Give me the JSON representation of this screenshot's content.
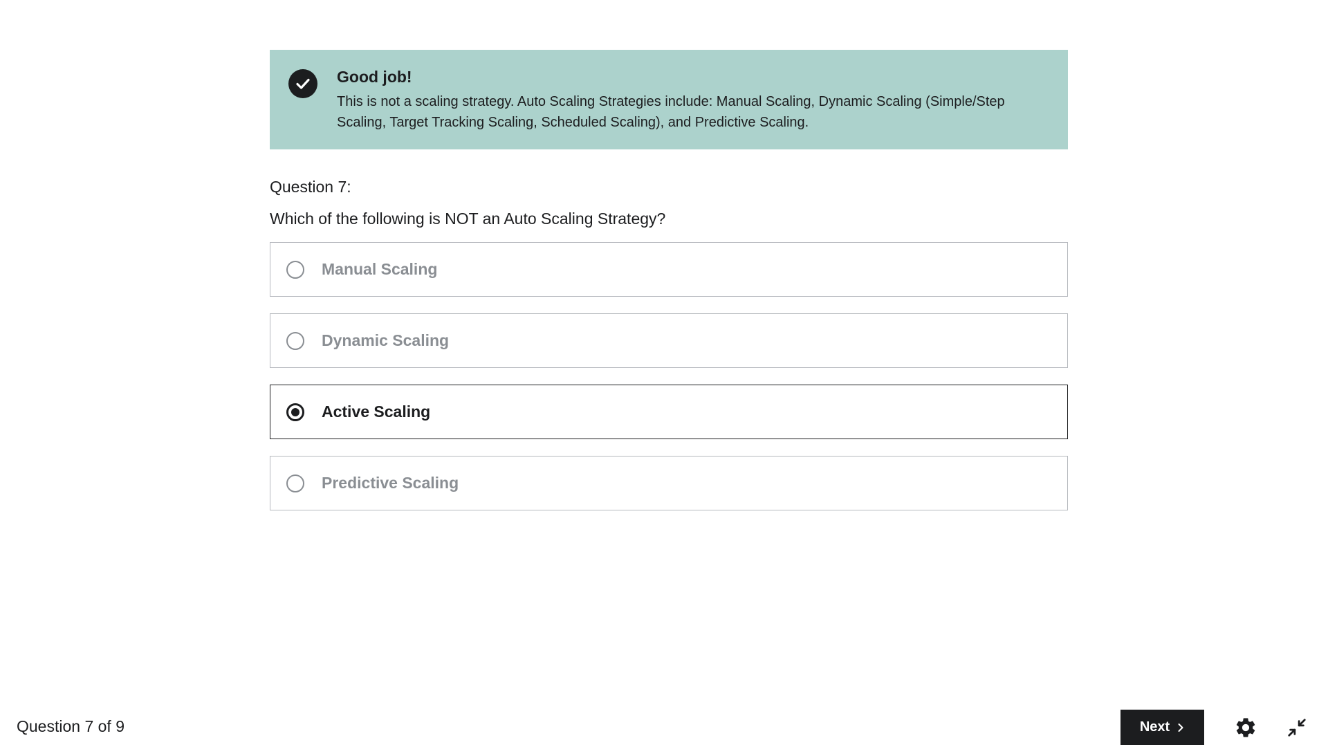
{
  "feedback": {
    "icon": "check-circle-icon",
    "title": "Good job!",
    "text": "This is not a scaling strategy. Auto Scaling Strategies include: Manual Scaling, Dynamic Scaling (Simple/Step Scaling, Target Tracking Scaling, Scheduled Scaling), and Predictive Scaling.",
    "background_color": "#acd2cc"
  },
  "question": {
    "number_label": "Question 7:",
    "text": "Which of the following is NOT an Auto Scaling Strategy?",
    "options": [
      {
        "label": "Manual Scaling",
        "selected": false
      },
      {
        "label": "Dynamic Scaling",
        "selected": false
      },
      {
        "label": "Active Scaling",
        "selected": true
      },
      {
        "label": "Predictive Scaling",
        "selected": false
      }
    ]
  },
  "footer": {
    "progress_label": "Question 7 of 9",
    "next_label": "Next",
    "settings_icon": "gear-icon",
    "exit_fullscreen_icon": "exit-fullscreen-icon"
  },
  "colors": {
    "primary": "#1c1d1f",
    "muted": "#8a8e93"
  }
}
